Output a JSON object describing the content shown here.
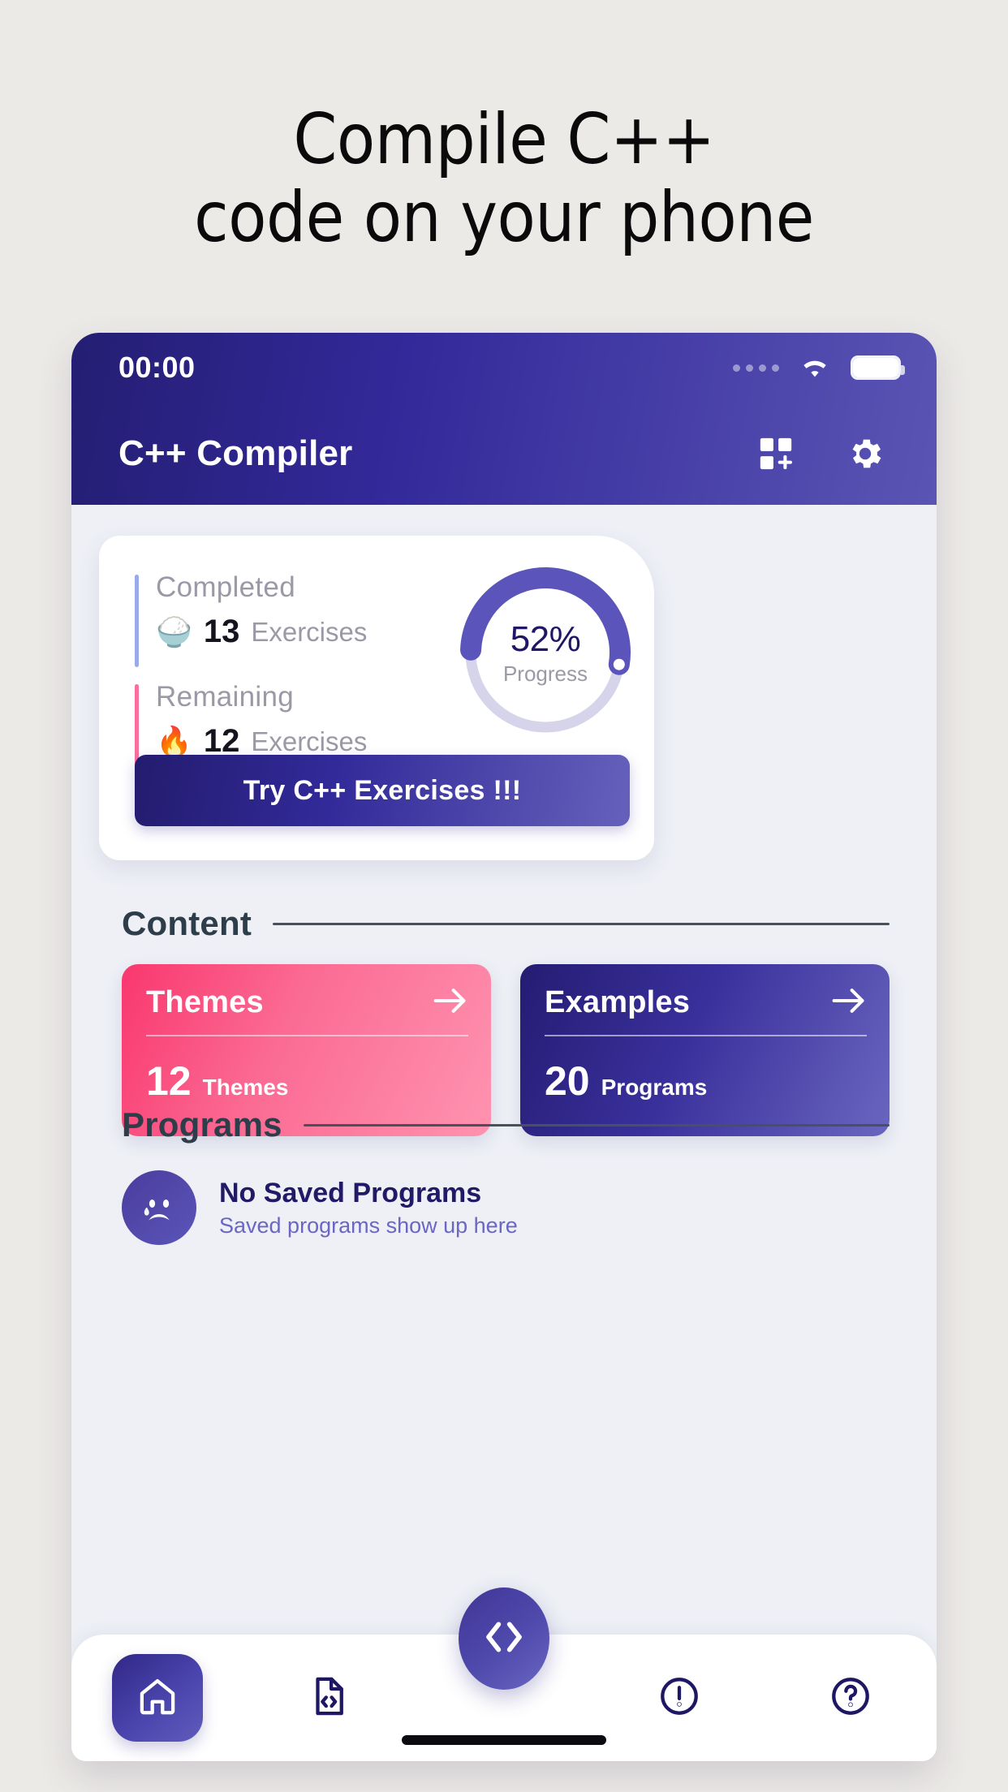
{
  "headline": "Compile C++\ncode on your phone",
  "statusbar": {
    "time": "00:00",
    "signal_icon": "signal-dots-icon",
    "wifi_icon": "wifi-icon",
    "battery_icon": "battery-full-icon"
  },
  "appbar": {
    "title": "C++ Compiler",
    "add_icon": "dashboard-add-icon",
    "settings_icon": "gear-icon"
  },
  "progress_card": {
    "completed": {
      "label": "Completed",
      "emoji": "🍚",
      "emoji_name": "bowl-emoji",
      "count": "13",
      "unit": "Exercises",
      "accent": "#9aa9e8"
    },
    "remaining": {
      "label": "Remaining",
      "emoji": "🔥",
      "emoji_name": "flame-emoji",
      "count": "12",
      "unit": "Exercises",
      "accent": "#f9709c"
    },
    "ring": {
      "percent_label": "52%",
      "caption": "Progress",
      "value": 52,
      "track_color": "#d6d4ea",
      "arc_color": "#5b55bb"
    },
    "cta_label": "Try C++ Exercises !!!"
  },
  "sections": {
    "content_title": "Content",
    "programs_title": "Programs"
  },
  "content_cards": [
    {
      "title": "Themes",
      "arrow_icon": "arrow-right-icon",
      "count": "12",
      "unit": "Themes",
      "color": "#fb6a92"
    },
    {
      "title": "Examples",
      "arrow_icon": "arrow-right-icon",
      "count": "20",
      "unit": "Programs",
      "color": "#3a309c"
    }
  ],
  "programs_empty": {
    "icon": "sad-face-icon",
    "title": "No Saved Programs",
    "subtitle": "Saved programs show up here"
  },
  "bottom_nav": {
    "items": [
      {
        "icon": "home-icon",
        "active": true
      },
      {
        "icon": "code-file-icon",
        "active": false
      },
      {
        "icon": "exclamation-circle-icon",
        "active": false
      },
      {
        "icon": "question-circle-icon",
        "active": false
      }
    ],
    "fab_icon": "code-brackets-icon"
  },
  "colors": {
    "page_background": "#eceae7",
    "app_background": "#eef0f6",
    "brand_dark": "#241e73",
    "brand_light": "#5a55b4",
    "pink": "#fb6a92",
    "heading": "#2d3e4a"
  }
}
